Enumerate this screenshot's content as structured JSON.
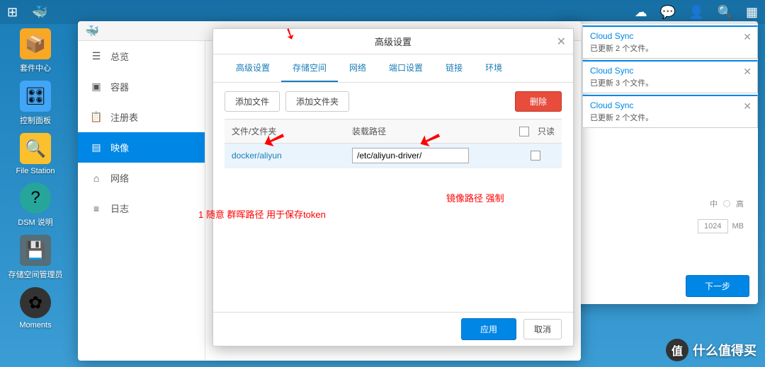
{
  "desktop": {
    "icons": [
      {
        "label": "套件中心",
        "color": "#f9a825",
        "glyph": "📦"
      },
      {
        "label": "控制面板",
        "color": "#42a5f5",
        "glyph": "🎛"
      },
      {
        "label": "File Station",
        "color": "#fbc02d",
        "glyph": "📁"
      },
      {
        "label": "DSM 说明",
        "color": "#26a69a",
        "glyph": "?"
      },
      {
        "label": "存储空间管理员",
        "color": "#546e7a",
        "glyph": "💾"
      },
      {
        "label": "Moments",
        "color": "#ab47bc",
        "glyph": "✿"
      }
    ]
  },
  "sidebar": {
    "items": [
      {
        "label": "总览"
      },
      {
        "label": "容器"
      },
      {
        "label": "注册表"
      },
      {
        "label": "映像"
      },
      {
        "label": "网络"
      },
      {
        "label": "日志"
      }
    ]
  },
  "modal": {
    "title": "高级设置",
    "tabs": [
      {
        "label": "高级设置"
      },
      {
        "label": "存储空间"
      },
      {
        "label": "网络"
      },
      {
        "label": "端口设置"
      },
      {
        "label": "链接"
      },
      {
        "label": "环境"
      }
    ],
    "buttons": {
      "add_file": "添加文件",
      "add_folder": "添加文件夹",
      "delete": "删除",
      "apply": "应用",
      "cancel": "取消"
    },
    "columns": {
      "folder": "文件/文件夹",
      "mount": "装载路径",
      "readonly": "只读"
    },
    "rows": [
      {
        "folder": "docker/aliyun",
        "mount": "/etc/aliyun-driver/"
      }
    ]
  },
  "annotations": {
    "left": "1 随意 群晖路径 用于保存token",
    "right": "镜像路径 强制"
  },
  "notifications": [
    {
      "title": "Cloud Sync",
      "body": "已更新 2 个文件。"
    },
    {
      "title": "Cloud Sync",
      "body": "已更新 3 个文件。"
    },
    {
      "title": "Cloud Sync",
      "body": "已更新 2 个文件。"
    }
  ],
  "right_panel": {
    "radio_mid": "中",
    "radio_high": "高",
    "value": "1024",
    "unit": "MB",
    "next": "下一步"
  },
  "watermark": "什么值得买"
}
